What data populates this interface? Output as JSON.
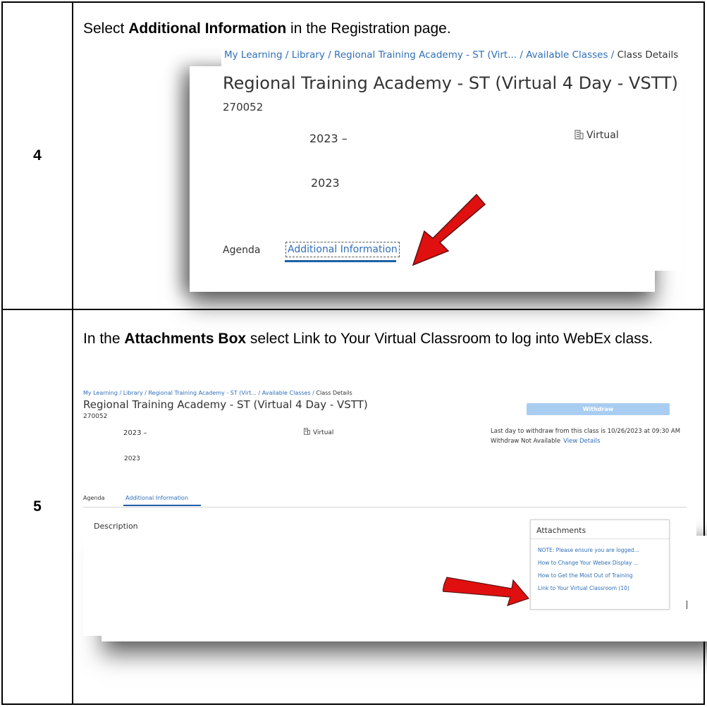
{
  "steps": [
    {
      "number": "4",
      "instruction_pre": "Select ",
      "instruction_bold": "Additional Information",
      "instruction_post": " in the Registration page.",
      "screenshot": {
        "breadcrumb": [
          "My Learning",
          "Library",
          "Regional Training Academy - ST (Virt...",
          "Available Classes"
        ],
        "breadcrumb_current": "Class Details",
        "title": "Regional Training Academy - ST (Virtual 4 Day - VSTT)",
        "code": "270052",
        "start_date": "2023  –",
        "end_date": "2023",
        "location": "Virtual",
        "tabs": [
          "Agenda",
          "Additional Information"
        ]
      }
    },
    {
      "number": "5",
      "instruction_pre": "In the ",
      "instruction_bold": "Attachments Box",
      "instruction_post": " select Link to Your Virtual Classroom to log into WebEx class.",
      "screenshot": {
        "breadcrumb": [
          "My Learning",
          "Library",
          "Regional Training Academy - ST (Virt...",
          "Available Classes"
        ],
        "breadcrumb_current": "Class Details",
        "title": "Regional Training Academy - ST (Virtual 4 Day - VSTT)",
        "code": "270052",
        "withdraw_button": "Withdraw",
        "start_date": "2023  –",
        "end_date": "2023",
        "location": "Virtual",
        "last_day": "Last day to withdraw from this class is 10/26/2023 at 09:30 AM",
        "withdraw_status": "Withdraw Not Available",
        "view_details": "View Details",
        "tabs": [
          "Agenda",
          "Additional Information"
        ],
        "description_label": "Description",
        "attachments_title": "Attachments",
        "attachments": [
          "NOTE: Please ensure you are logged...",
          "How to Change Your Webex Display ...",
          "How to Get the Most Out of Training",
          "Link to Your Virtual Classroom (10)"
        ]
      }
    }
  ],
  "colors": {
    "link": "#2f6fb7",
    "arrow": "#e01010",
    "withdraw": "#a9cdf0"
  },
  "icons": [
    "building-icon",
    "red-arrow-icon"
  ]
}
